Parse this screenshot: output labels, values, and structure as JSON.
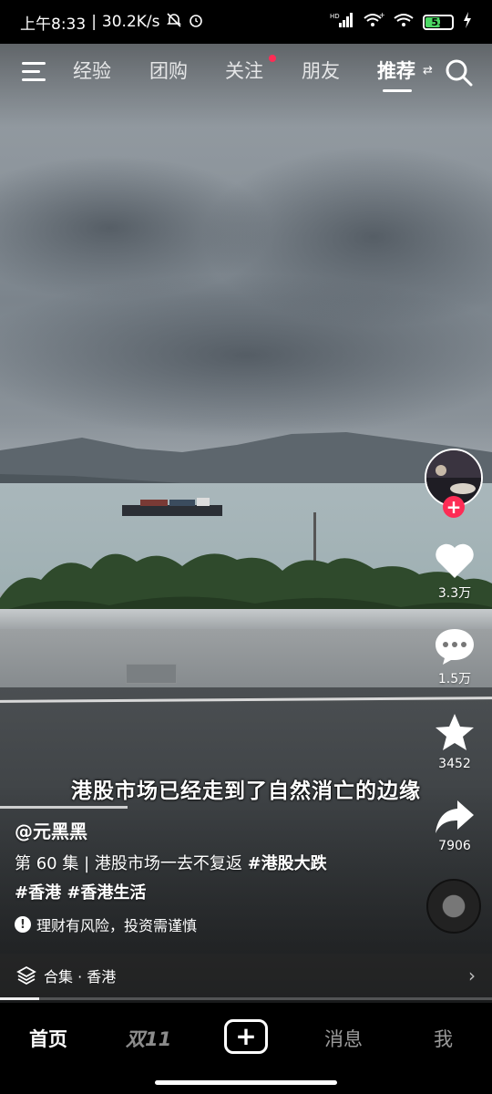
{
  "status_bar": {
    "time": "上午8:33",
    "speed": "30.2K/s",
    "network": "HD",
    "battery": "53",
    "battery_color": "#4cd964"
  },
  "top_nav": {
    "menu_icon": "menu-icon",
    "tabs": [
      {
        "label": "经验"
      },
      {
        "label": "团购"
      },
      {
        "label": "关注",
        "has_dot": true
      },
      {
        "label": "朋友"
      },
      {
        "label": "推荐",
        "active": true
      }
    ],
    "search_icon": "search-icon"
  },
  "video": {
    "subtitle": "港股市场已经走到了自然消亡的边缘",
    "author": "@元黑黑",
    "description_prefix": "第 60 集 | 港股市场一去不复返 ",
    "tags_line1": "#港股大跌",
    "tags_line2": "#香港 #香港生活",
    "risk_notice": "理财有风险，投资需谨慎",
    "collection": "合集 · 香港",
    "progress_fraction": 0.08
  },
  "actions": {
    "follow_label": "+",
    "likes": "3.3万",
    "comments": "1.5万",
    "favorites": "3452",
    "shares": "7906"
  },
  "bottom_nav": {
    "home": "首页",
    "double11": "双11",
    "create": "+",
    "messages": "消息",
    "me": "我"
  },
  "colors": {
    "accent": "#fe2c55"
  }
}
